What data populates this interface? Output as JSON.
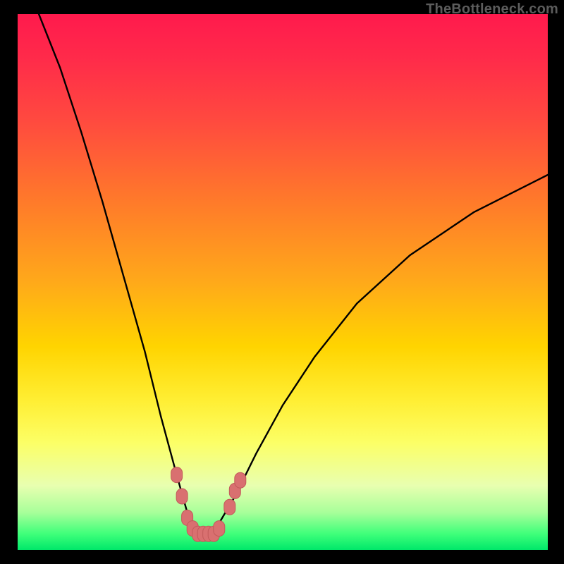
{
  "watermark": "TheBottleneck.com",
  "colors": {
    "background": "#000000",
    "gradient_top": "#ff1a4d",
    "gradient_bottom": "#00e86a",
    "curve": "#000000",
    "marker": "#d97070"
  },
  "chart_data": {
    "type": "line",
    "title": "",
    "xlabel": "",
    "ylabel": "",
    "xlim": [
      0,
      100
    ],
    "ylim": [
      0,
      100
    ],
    "note": "Axes are implicit (no tick labels shown). Values estimated from pixel positions. Y decreases toward the V-shaped notch near x≈35 then rises again.",
    "series": [
      {
        "name": "curve",
        "x": [
          4,
          8,
          12,
          16,
          20,
          24,
          27,
          30,
          32,
          34,
          36,
          38,
          41,
          45,
          50,
          56,
          64,
          74,
          86,
          100
        ],
        "y": [
          100,
          90,
          78,
          65,
          51,
          37,
          25,
          14,
          7,
          3,
          3,
          5,
          10,
          18,
          27,
          36,
          46,
          55,
          63,
          70
        ]
      }
    ],
    "markers": {
      "name": "highlighted-points",
      "note": "Pink rounded markers clustered near the trough of the curve.",
      "points": [
        {
          "x": 30,
          "y": 14
        },
        {
          "x": 31,
          "y": 10
        },
        {
          "x": 32,
          "y": 6
        },
        {
          "x": 33,
          "y": 4
        },
        {
          "x": 34,
          "y": 3
        },
        {
          "x": 35,
          "y": 3
        },
        {
          "x": 36,
          "y": 3
        },
        {
          "x": 37,
          "y": 3
        },
        {
          "x": 38,
          "y": 4
        },
        {
          "x": 40,
          "y": 8
        },
        {
          "x": 41,
          "y": 11
        },
        {
          "x": 42,
          "y": 13
        }
      ]
    }
  }
}
